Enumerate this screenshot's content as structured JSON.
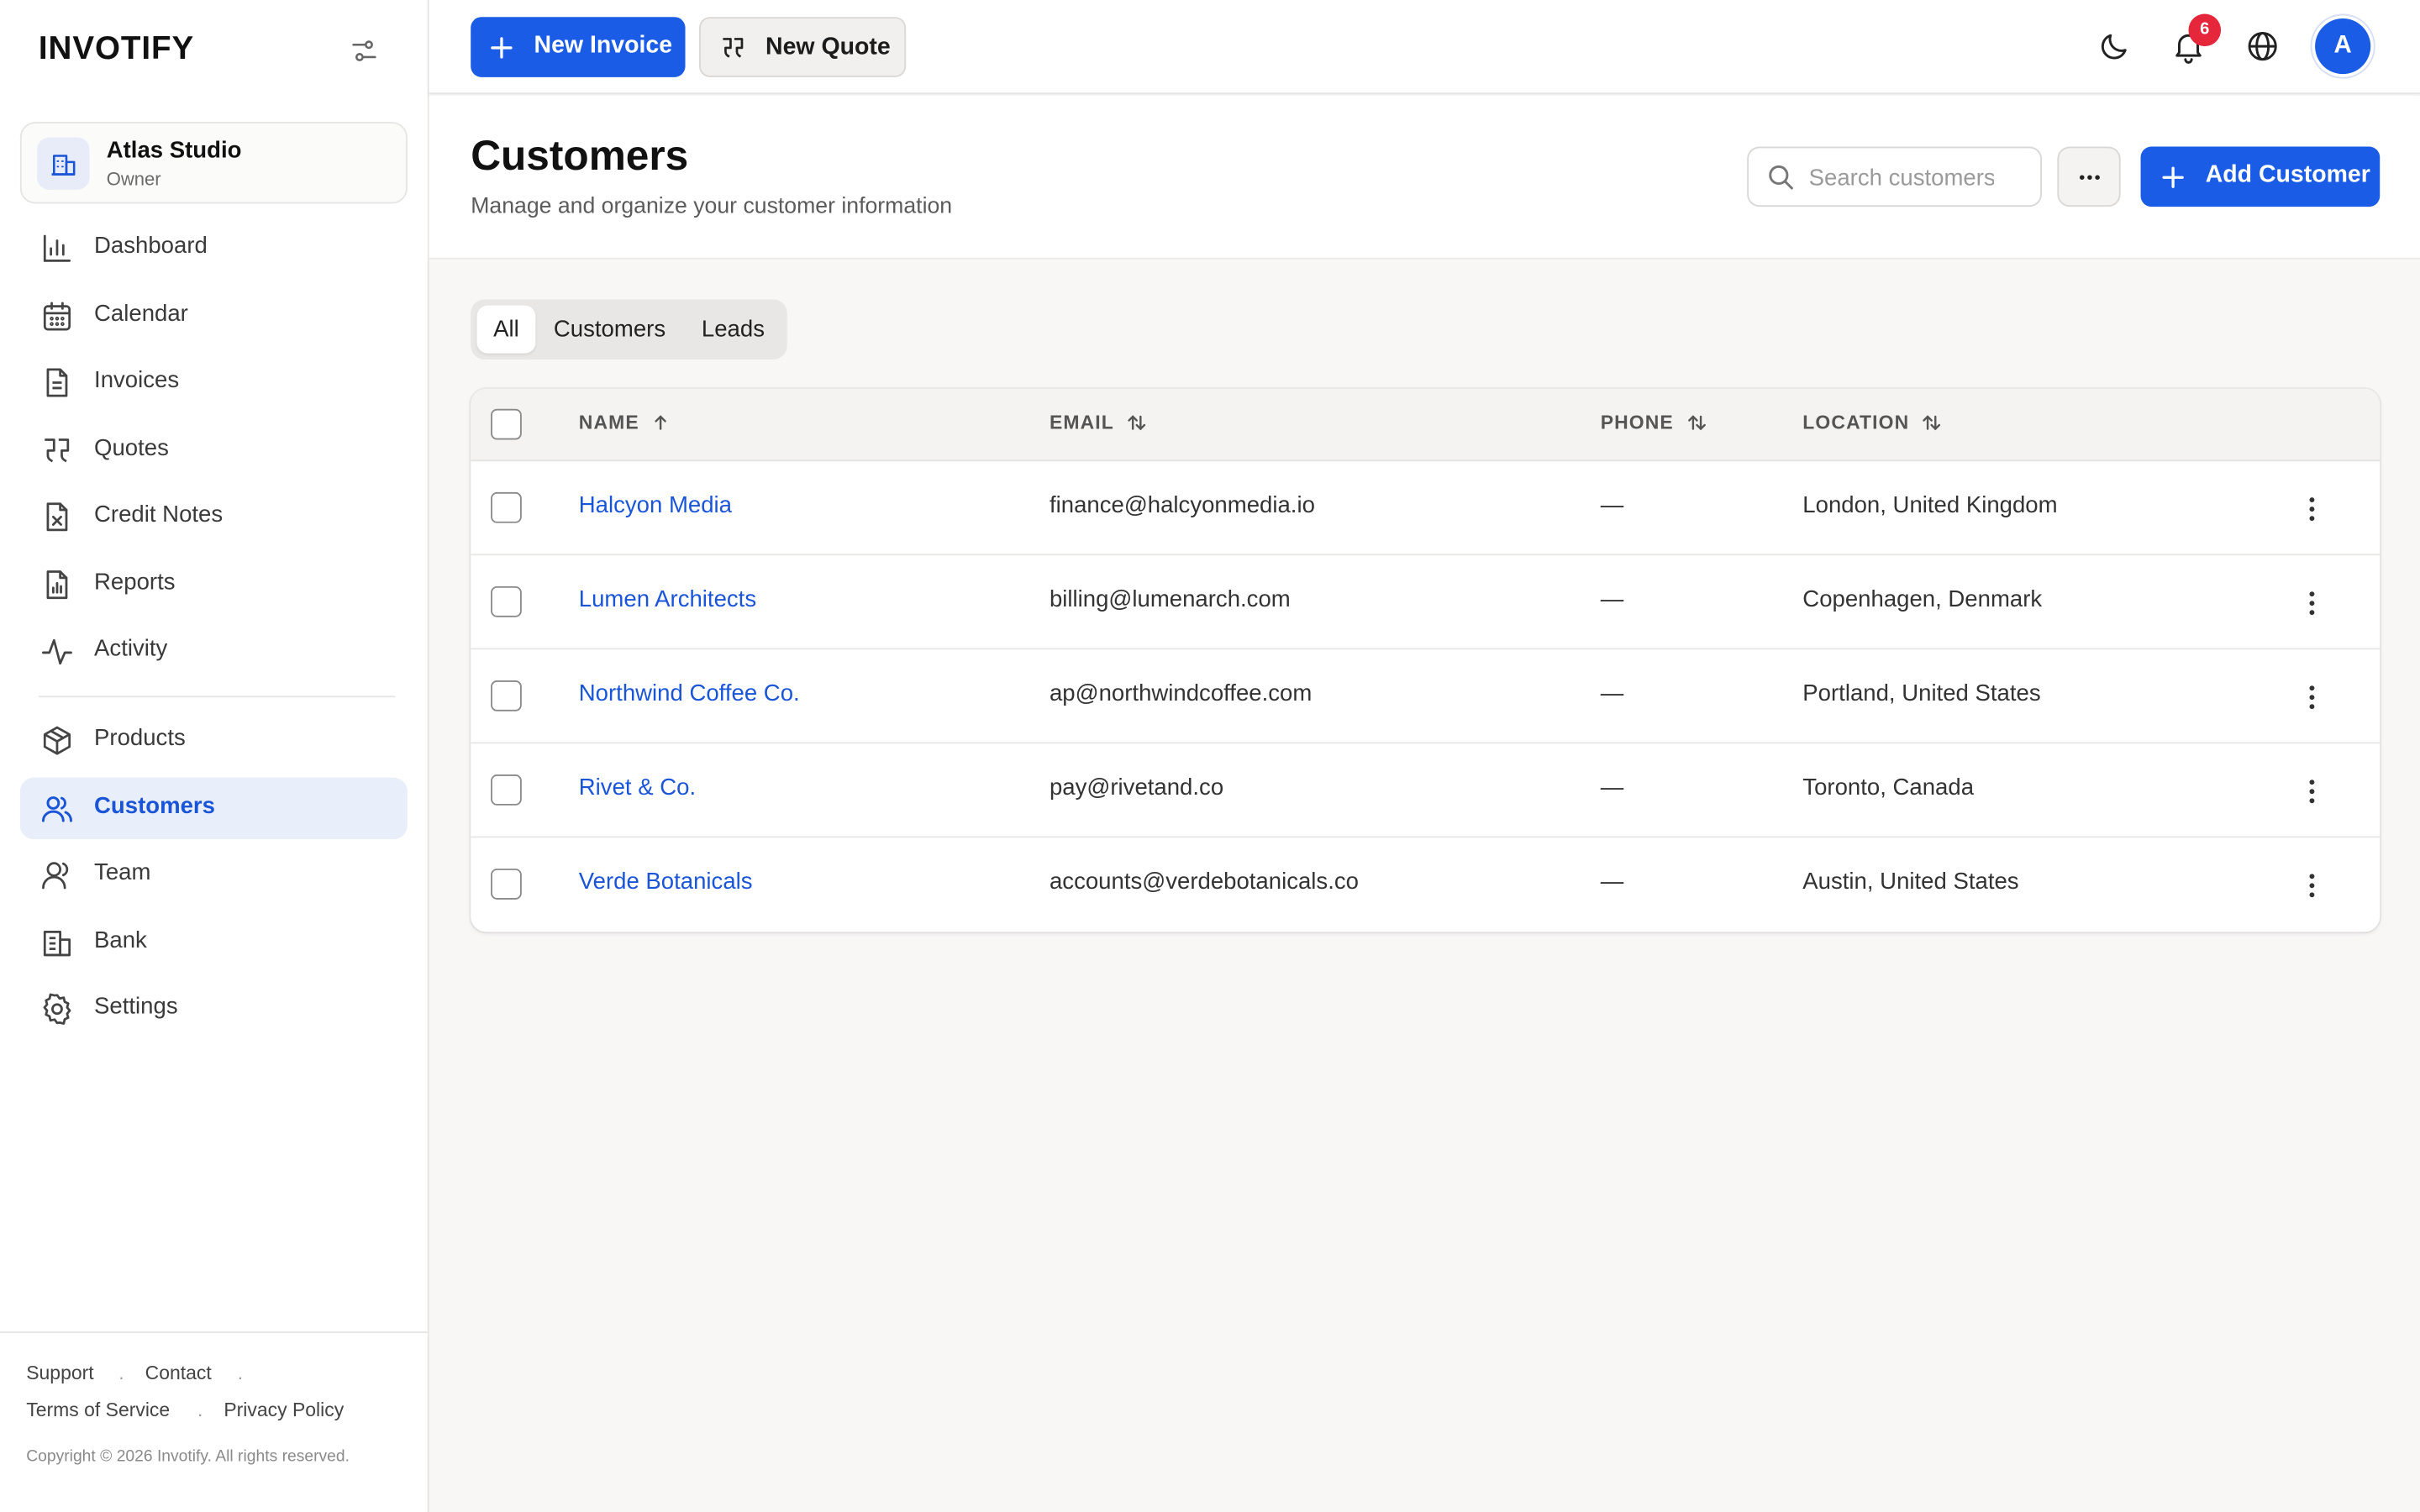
{
  "app": {
    "brand": "INVOTIFY"
  },
  "org": {
    "name": "Atlas Studio",
    "role": "Owner"
  },
  "sidebar": {
    "items": [
      {
        "label": "Dashboard",
        "icon": "bar-chart-icon"
      },
      {
        "label": "Calendar",
        "icon": "calendar-icon"
      },
      {
        "label": "Invoices",
        "icon": "document-icon"
      },
      {
        "label": "Quotes",
        "icon": "quote-icon"
      },
      {
        "label": "Credit Notes",
        "icon": "document-x-icon"
      },
      {
        "label": "Reports",
        "icon": "report-icon"
      },
      {
        "label": "Activity",
        "icon": "activity-icon"
      },
      {
        "label": "Products",
        "icon": "package-icon"
      },
      {
        "label": "Customers",
        "icon": "users-icon",
        "active": true
      },
      {
        "label": "Team",
        "icon": "user-icon"
      },
      {
        "label": "Bank",
        "icon": "bank-icon"
      },
      {
        "label": "Settings",
        "icon": "gear-icon"
      }
    ],
    "footer": {
      "support": "Support",
      "contact": "Contact",
      "terms": "Terms of Service",
      "privacy": "Privacy Policy",
      "separator": ".",
      "copyright": "Copyright © 2026 Invotify. All rights reserved."
    }
  },
  "topbar": {
    "new_invoice": "New Invoice",
    "new_quote": "New Quote",
    "notification_count": "6",
    "avatar_initial": "A"
  },
  "page": {
    "title": "Customers",
    "subtitle": "Manage and organize your customer information",
    "search_placeholder": "Search customers...",
    "add_button": "Add Customer"
  },
  "tabs": [
    {
      "label": "All",
      "active": true
    },
    {
      "label": "Customers"
    },
    {
      "label": "Leads"
    }
  ],
  "table": {
    "columns": [
      "NAME",
      "EMAIL",
      "PHONE",
      "LOCATION"
    ],
    "rows": [
      {
        "name": "Halcyon Media",
        "email": "finance@halcyonmedia.io",
        "phone": "—",
        "location": "London, United Kingdom"
      },
      {
        "name": "Lumen Architects",
        "email": "billing@lumenarch.com",
        "phone": "—",
        "location": "Copenhagen, Denmark"
      },
      {
        "name": "Northwind Coffee Co.",
        "email": "ap@northwindcoffee.com",
        "phone": "—",
        "location": "Portland, United States"
      },
      {
        "name": "Rivet & Co.",
        "email": "pay@rivetand.co",
        "phone": "—",
        "location": "Toronto, Canada"
      },
      {
        "name": "Verde Botanicals",
        "email": "accounts@verdebotanicals.co",
        "phone": "—",
        "location": "Austin, United States"
      }
    ]
  },
  "colors": {
    "accent": "#1a5ce5",
    "link": "#1a55d8",
    "badge": "#e5263b",
    "active_nav_bg": "#e9eefb"
  }
}
